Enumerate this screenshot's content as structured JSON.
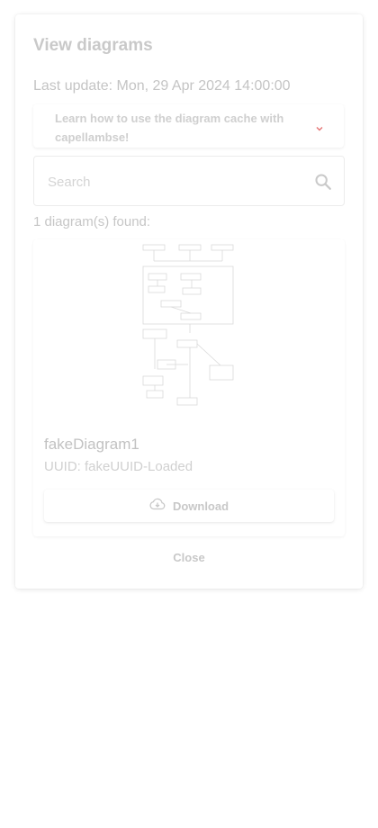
{
  "dialog": {
    "title": "View diagrams",
    "last_update": "Last update: Mon, 29 Apr 2024 14:00:00",
    "info": {
      "text": "Learn how to use the diagram cache with capellambse!"
    },
    "search": {
      "placeholder": "Search",
      "value": ""
    },
    "found_count": "1 diagram(s) found:",
    "diagrams": [
      {
        "name": "fakeDiagram1",
        "uuid": "UUID: fakeUUID-Loaded",
        "download_label": "Download"
      }
    ],
    "close_label": "Close"
  },
  "colors": {
    "text_faded": "#c6c6c6",
    "expand_icon": "#e57373",
    "diagram_lines": "#d6d6d6"
  },
  "icons": {
    "search": "search-icon",
    "download": "cloud-download-icon",
    "expand": "chevron-down-icon"
  }
}
